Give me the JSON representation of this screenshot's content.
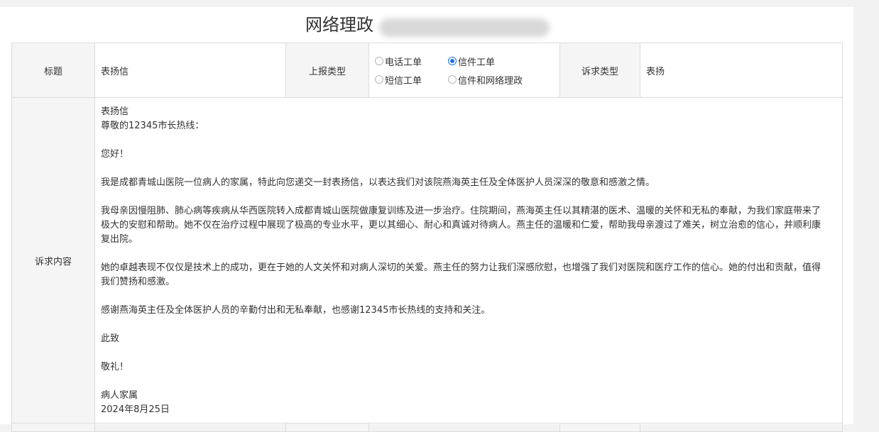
{
  "page": {
    "title": "网络理政"
  },
  "form": {
    "title_label": "标题",
    "title_value": "表扬信",
    "report_type_label": "上报类型",
    "report_types": [
      {
        "label": "电话工单",
        "checked": false
      },
      {
        "label": "信件工单",
        "checked": true
      },
      {
        "label": "短信工单",
        "checked": false
      },
      {
        "label": "信件和网络理政",
        "checked": false
      }
    ],
    "appeal_type_label": "诉求类型",
    "appeal_type_value": "表扬",
    "content_label": "诉求内容",
    "content": [
      "表扬信",
      "尊敬的12345市长热线：",
      "",
      "您好！",
      "",
      "我是成都青城山医院一位病人的家属，特此向您递交一封表扬信，以表达我们对该院燕海英主任及全体医护人员深深的敬意和感激之情。",
      "",
      "我母亲因慢阻肺、肺心病等疾病从华西医院转入成都青城山医院做康复训练及进一步治疗。住院期间，燕海英主任以其精湛的医术、温暖的关怀和无私的奉献，为我们家庭带来了极大的安慰和帮助。她不仅在治疗过程中展现了极高的专业水平，更以其细心、耐心和真诚对待病人。燕主任的温暖和仁爱，帮助我母亲渡过了难关，树立治愈的信心，并顺利康复出院。",
      "",
      "她的卓越表现不仅仅是技术上的成功，更在于她的人文关怀和对病人深切的关爱。燕主任的努力让我们深感欣慰，也增强了我们对医院和医疗工作的信心。她的付出和贡献，值得我们赞扬和感激。",
      "",
      "感谢燕海英主任及全体医护人员的辛勤付出和无私奉献，也感谢12345市长热线的支持和关注。",
      "",
      "此致",
      "",
      "敬礼！",
      "",
      "病人家属",
      "2024年8月25日"
    ]
  }
}
